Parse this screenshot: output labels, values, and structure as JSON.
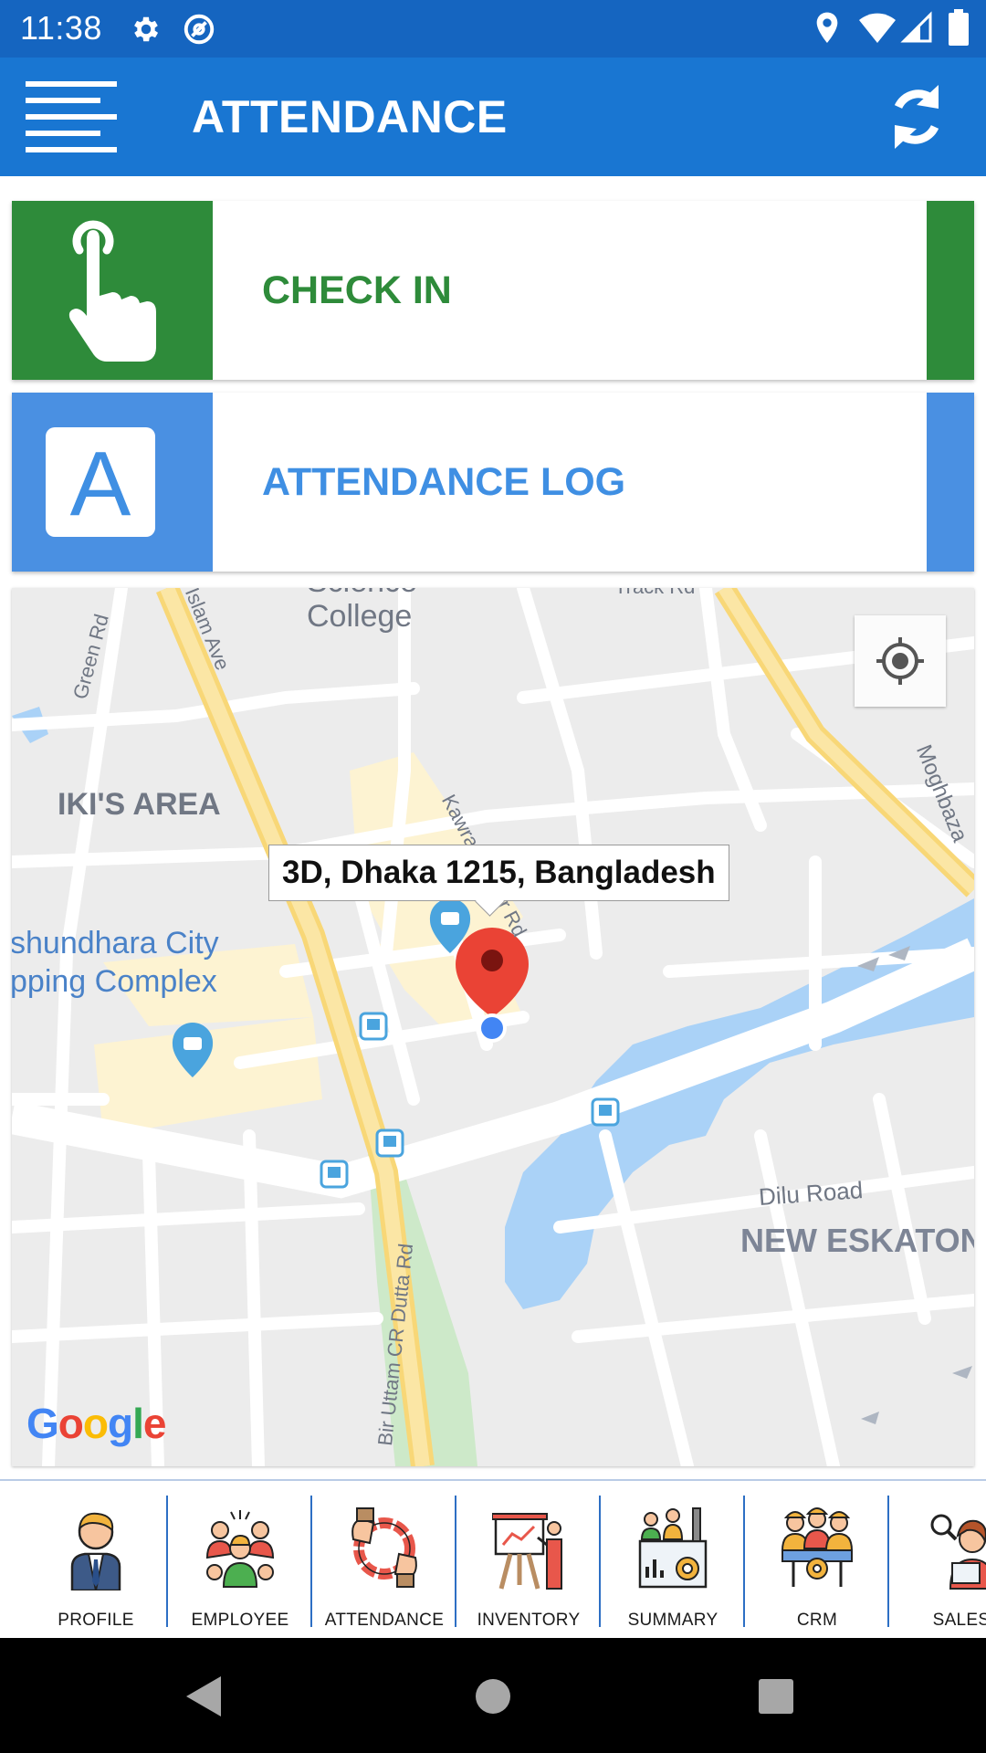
{
  "status_bar": {
    "time": "11:38",
    "icons": [
      "settings-icon",
      "at-sign-icon",
      "location-icon",
      "wifi-icon",
      "signal-icon",
      "battery-icon"
    ]
  },
  "app_bar": {
    "title": "ATTENDANCE",
    "menu_icon": "menu-icon",
    "refresh_icon": "refresh-icon",
    "color": "#1976d2"
  },
  "actions": {
    "check_in": {
      "label": "CHECK IN",
      "icon": "tap-hand-icon",
      "color": "#2e8b3a"
    },
    "attendance_log": {
      "label": "ATTENDANCE LOG",
      "icon_letter": "A",
      "color": "#4a90e2"
    }
  },
  "map": {
    "address": "3D, Dhaka 1215, Bangladesh",
    "labels": {
      "science_college": "Science",
      "college": "College",
      "green_rd": "Green Rd",
      "islam_ave": "Islam Ave",
      "track_rd": "Track Rd",
      "moghbazar": "Moghbaza",
      "area": "IKI'S AREA",
      "kawran_bazar": "Kawran Bazar Rd",
      "city_1": "shundhara City",
      "city_2": "pping Complex",
      "dilu_road": "Dilu Road",
      "new_eskaton": "NEW ESKATON",
      "bir_uttam": "Bir Uttam CR Dutta Rd"
    },
    "logo": "Google",
    "my_location_icon": "my-location-icon"
  },
  "bottom_nav": {
    "items": [
      {
        "label": "PROFILE",
        "icon": "profile-icon"
      },
      {
        "label": "EMPLOYEE",
        "icon": "employee-icon"
      },
      {
        "label": "ATTENDANCE",
        "icon": "attendance-icon"
      },
      {
        "label": "INVENTORY",
        "icon": "inventory-icon"
      },
      {
        "label": "SUMMARY",
        "icon": "summary-icon"
      },
      {
        "label": "CRM",
        "icon": "crm-icon"
      },
      {
        "label": "SALES",
        "icon": "sales-icon"
      }
    ]
  },
  "system_nav": [
    "back-icon",
    "home-icon",
    "recents-icon"
  ]
}
